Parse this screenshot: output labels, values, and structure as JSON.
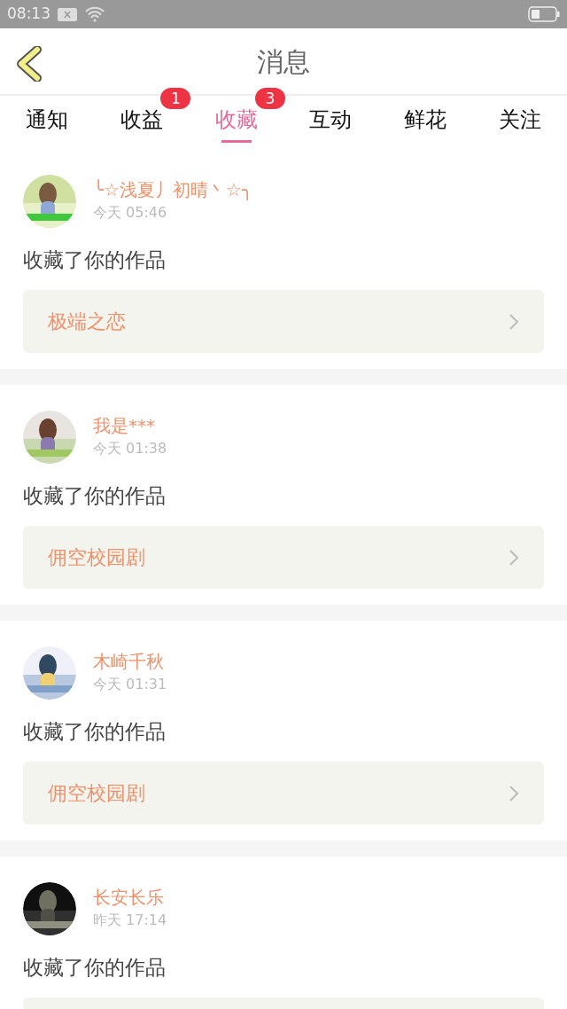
{
  "status_bar": {
    "time": "08:13"
  },
  "header": {
    "title": "消息"
  },
  "tabs": [
    {
      "label": "通知",
      "selected": false
    },
    {
      "label": "收益",
      "selected": false,
      "badge": "1"
    },
    {
      "label": "收藏",
      "selected": true,
      "badge": "3"
    },
    {
      "label": "互动",
      "selected": false
    },
    {
      "label": "鲜花",
      "selected": false
    },
    {
      "label": "关注",
      "selected": false
    }
  ],
  "messages": [
    {
      "user": "╰☆浅夏丿初晴丶☆╮",
      "time": "今天 05:46",
      "action": "收藏了你的作品",
      "work_title": "极端之恋"
    },
    {
      "user": "我是***",
      "time": "今天 01:38",
      "action": "收藏了你的作品",
      "work_title": "佣空校园剧"
    },
    {
      "user": "木崎千秋",
      "time": "今天 01:31",
      "action": "收藏了你的作品",
      "work_title": "佣空校园剧"
    },
    {
      "user": "长安长乐",
      "time": "昨天 17:14",
      "action": "收藏了你的作品",
      "work_shown": true
    }
  ]
}
